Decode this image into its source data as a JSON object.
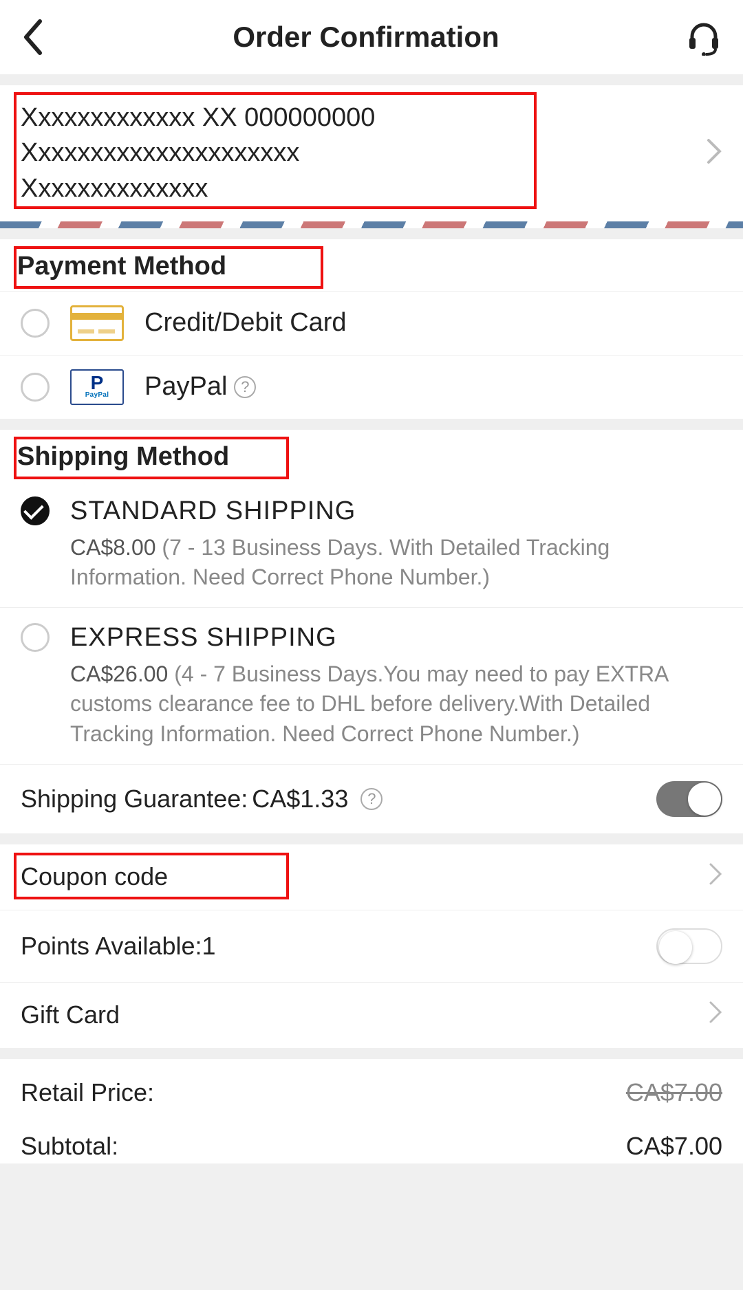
{
  "header": {
    "title": "Order Confirmation"
  },
  "address": {
    "line1": "Xxxxxxxxxxxxx XX 000000000",
    "line2": "Xxxxxxxxxxxxxxxxxxxxx",
    "line3": "Xxxxxxxxxxxxxx"
  },
  "payment": {
    "heading": "Payment Method",
    "options": [
      {
        "label": "Credit/Debit Card"
      },
      {
        "label": "PayPal"
      }
    ]
  },
  "shipping": {
    "heading": "Shipping Method",
    "options": [
      {
        "title": "STANDARD SHIPPING",
        "price": "CA$8.00",
        "desc": "(7 - 13 Business Days. With Detailed Tracking Information. Need Correct Phone Number.)",
        "selected": true
      },
      {
        "title": "EXPRESS SHIPPING",
        "price": "CA$26.00",
        "desc": "(4 - 7 Business Days.You may need to pay EXTRA customs clearance fee to DHL before delivery.With Detailed Tracking Information. Need Correct Phone Number.)",
        "selected": false
      }
    ],
    "guarantee_label": "Shipping Guarantee:",
    "guarantee_price": "CA$1.33"
  },
  "coupon": {
    "label": "Coupon code"
  },
  "points": {
    "label": "Points Available:",
    "value": "1"
  },
  "giftcard": {
    "label": "Gift Card"
  },
  "totals": {
    "retail_label": "Retail Price:",
    "retail_value": "CA$7.00",
    "subtotal_label": "Subtotal:",
    "subtotal_value": "CA$7.00"
  }
}
